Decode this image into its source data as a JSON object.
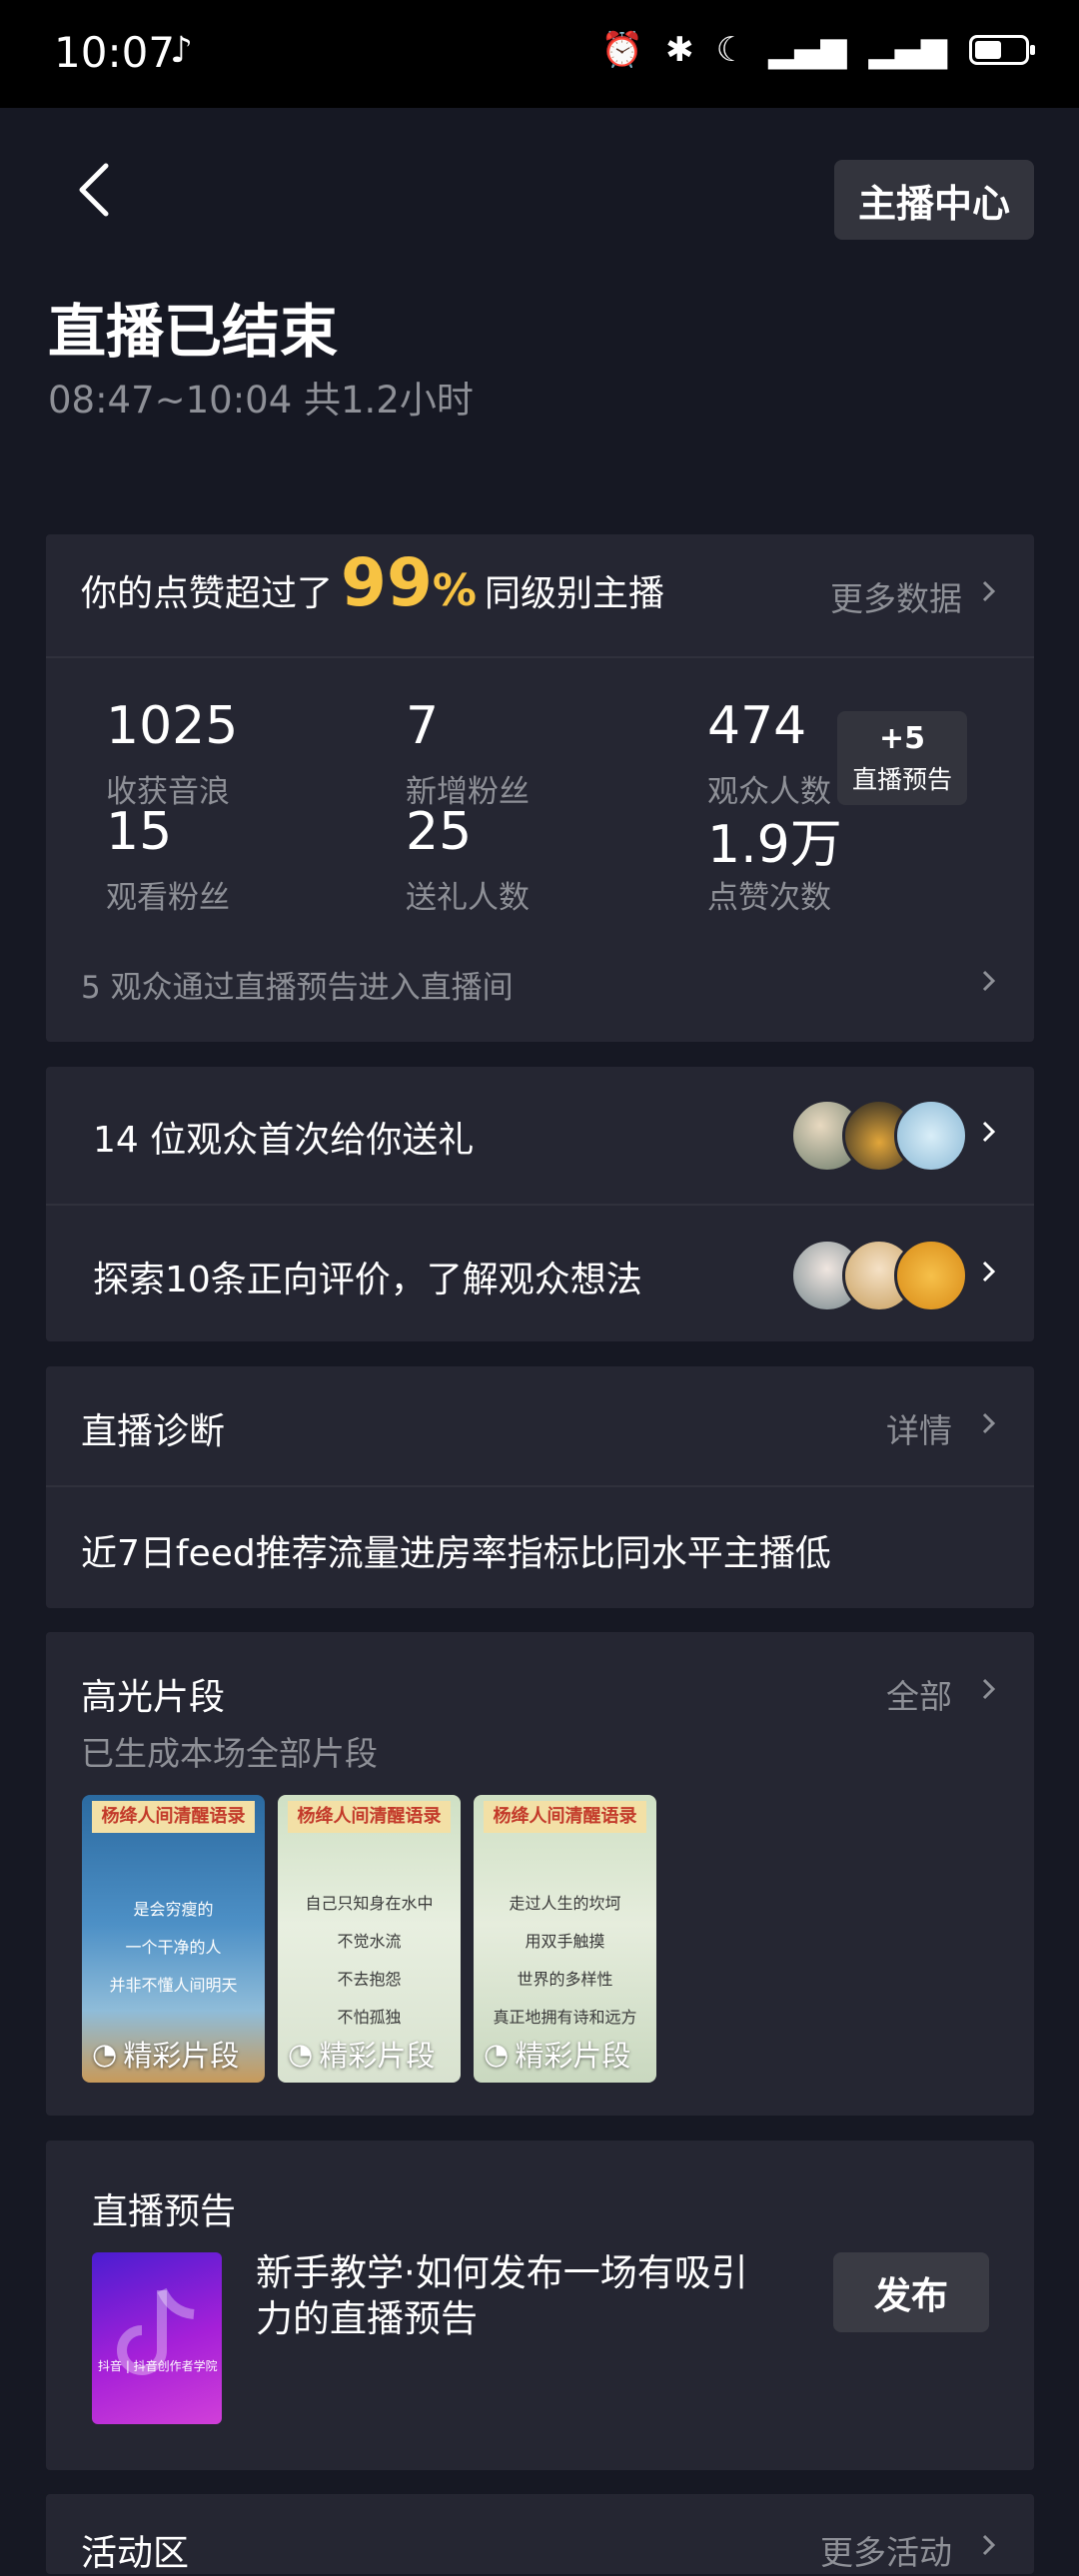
{
  "status_bar": {
    "time": "10:07",
    "battery_level": 0.55
  },
  "header": {
    "anchor_center_label": "主播中心",
    "title": "直播已结束",
    "time_range": "08:47~10:04 共1.2小时"
  },
  "summary": {
    "likes_prefix": "你的点赞超过了",
    "likes_percent": "99",
    "likes_percent_unit": "%",
    "likes_suffix": "同级别主播",
    "more_data_label": "更多数据",
    "stats": [
      {
        "value": "1025",
        "label": "收获音浪"
      },
      {
        "value": "7",
        "label": "新增粉丝"
      },
      {
        "value": "474",
        "label": "观众人数"
      },
      {
        "value": "15",
        "label": "观看粉丝"
      },
      {
        "value": "25",
        "label": "送礼人数"
      },
      {
        "value": "1.9万",
        "label": "点赞次数"
      }
    ],
    "preview_badge": {
      "value": "+5",
      "label": "直播预告"
    },
    "preview_entry_text": "5 观众通过直播预告进入直播间"
  },
  "audience": {
    "first_gift_text": "14 位观众首次给你送礼",
    "reviews_text": "探索10条正向评价，了解观众想法"
  },
  "diagnosis": {
    "title": "直播诊断",
    "details_label": "详情",
    "message": "近7日feed推荐流量进房率指标比同水平主播低"
  },
  "highlights": {
    "title": "高光片段",
    "all_label": "全部",
    "subtitle": "已生成本场全部片段",
    "clips": [
      {
        "banner": "杨绛人间清醒语录",
        "lines": [
          "是会穷瘦的",
          "一个干净的人",
          "并非不懂人间明天"
        ],
        "label": "精彩片段"
      },
      {
        "banner": "杨绛人间清醒语录",
        "lines": [
          "自己只知身在水中",
          "不觉水流",
          "不去抱怨",
          "不怕孤独"
        ],
        "label": "精彩片段"
      },
      {
        "banner": "杨绛人间清醒语录",
        "lines": [
          "走过人生的坎坷",
          "用双手触摸",
          "世界的多样性",
          "真正地拥有诗和远方"
        ],
        "label": "精彩片段"
      }
    ]
  },
  "live_preview": {
    "title": "直播预告",
    "thumb_caption": "抖音 | 抖音创作者学院",
    "description": "新手教学·如何发布一场有吸引力的直播预告",
    "publish_label": "发布"
  },
  "activity": {
    "title": "活动区",
    "more_label": "更多活动"
  },
  "colors": {
    "background": "#161823",
    "card": "#252632",
    "accent_gold": "#f7c343",
    "muted_text": "#8e9097"
  }
}
